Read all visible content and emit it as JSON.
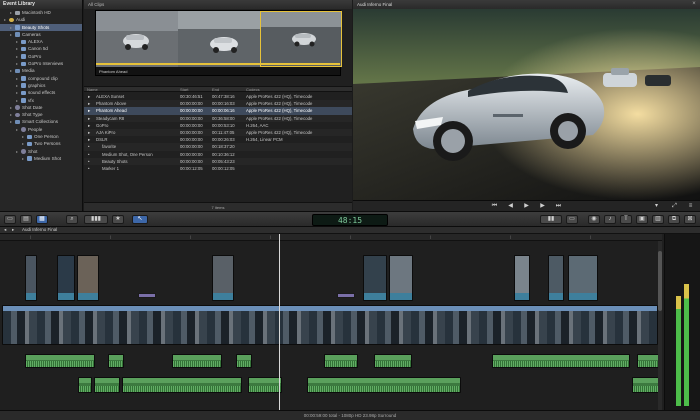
{
  "library": {
    "title": "Event Library",
    "items": [
      {
        "label": "Macintosh HD",
        "icon": "drive"
      },
      {
        "label": "Audi",
        "icon": "star"
      },
      {
        "label": "Beauty Shots",
        "icon": "coll",
        "selected": true
      },
      {
        "label": "Cameras",
        "icon": "folder"
      },
      {
        "label": "ALEXA",
        "icon": "coll"
      },
      {
        "label": "Canon 5d",
        "icon": "coll"
      },
      {
        "label": "GoPro",
        "icon": "coll"
      },
      {
        "label": "GoPro Interviews",
        "icon": "coll"
      },
      {
        "label": "Media",
        "icon": "folder"
      },
      {
        "label": "compound clip",
        "icon": "coll"
      },
      {
        "label": "graphics",
        "icon": "coll"
      },
      {
        "label": "sound effects",
        "icon": "coll"
      },
      {
        "label": "vfx",
        "icon": "coll"
      },
      {
        "label": "Shot Date",
        "icon": "cog"
      },
      {
        "label": "Shot Type",
        "icon": "cog"
      },
      {
        "label": "Smart Collections",
        "icon": "folder"
      },
      {
        "label": "People",
        "icon": "cog"
      },
      {
        "label": "One Person",
        "icon": "coll"
      },
      {
        "label": "Two Persons",
        "icon": "coll"
      },
      {
        "label": "Shot",
        "icon": "cog"
      },
      {
        "label": "Medium Shot",
        "icon": "coll"
      }
    ]
  },
  "browser": {
    "top_label": "All Clips",
    "strip_label": "Phantom Ahead",
    "columns": {
      "name": "Name",
      "start": "Start",
      "end": "End",
      "codecs": "Codecs"
    },
    "rows": [
      {
        "name": "ALEXA Sunset",
        "start": "00:30:46:51",
        "end": "00:47:38:16",
        "codecs": "Apple ProRes 422 (HQ), Timecode"
      },
      {
        "name": "Phantom Above",
        "start": "00:00:00:00",
        "end": "00:00:16:03",
        "codecs": "Apple ProRes 422 (HQ), Timecode"
      },
      {
        "name": "Phantom Ahead",
        "start": "00:00:00:00",
        "end": "00:00:06:16",
        "codecs": "Apple ProRes 422 (HQ), Timecode",
        "selected": true
      },
      {
        "name": "Steadycam R8",
        "start": "00:00:00:00",
        "end": "00:36:58:00",
        "codecs": "Apple ProRes 422 (HQ), Timecode"
      },
      {
        "name": "GoPro",
        "start": "00:00:00:00",
        "end": "00:00:53:10",
        "codecs": "H.264, AAC"
      },
      {
        "name": "AJA KiPro",
        "start": "00:00:00:00",
        "end": "00:11:47:05",
        "codecs": "Apple ProRes 422 (HQ), Timecode"
      },
      {
        "name": "DSLR",
        "start": "00:00:00:00",
        "end": "00:00:26:03",
        "codecs": "H.264, Linear PCM"
      },
      {
        "name": "favorite",
        "start": "00:00:00:00",
        "end": "00:18:37:20",
        "codecs": ""
      },
      {
        "name": "Medium Shot, One Person",
        "start": "00:00:00:00",
        "end": "00:10:36:12",
        "codecs": ""
      },
      {
        "name": "Beauty Shots",
        "start": "00:00:00:00",
        "end": "00:05:43:23",
        "codecs": ""
      },
      {
        "name": "Marker 1",
        "start": "00:00:12:05",
        "end": "00:00:12:05",
        "codecs": ""
      }
    ],
    "footer": "7 items"
  },
  "viewer": {
    "title": "Audi Inferno Final"
  },
  "toolbar": {
    "timecode": "48:15"
  },
  "timeline": {
    "project_title": "Audi Inferno Final",
    "footer": "00:00:59:00 total - 1080p HD 23.98p Surround"
  },
  "colors": {
    "accent": "#e6c23a",
    "video_clip": "#3f6488",
    "audio_clip": "#3c7a3f",
    "title_clip": "#7a6fa8"
  }
}
